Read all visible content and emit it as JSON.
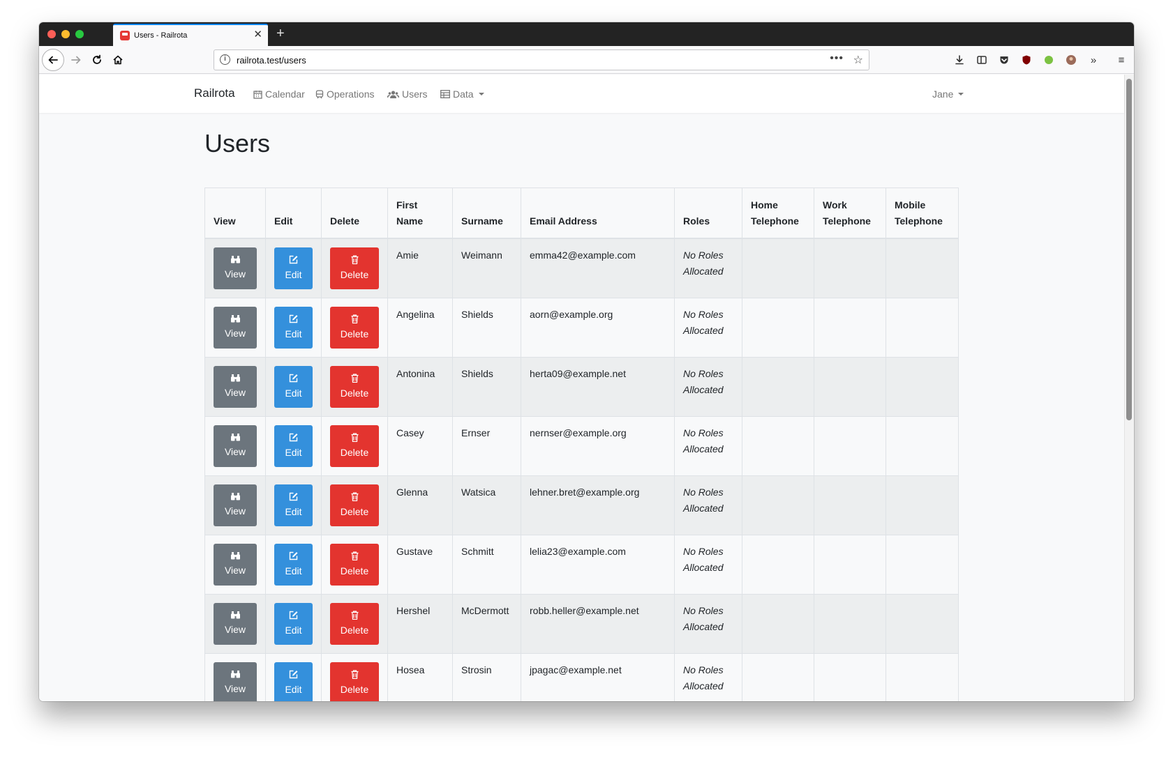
{
  "browser": {
    "tab_title": "Users - Railrota",
    "tab_close": "✕",
    "new_tab": "+",
    "url": "railrota.test/users"
  },
  "app": {
    "brand": "Railrota",
    "nav": {
      "calendar": "Calendar",
      "operations": "Operations",
      "users": "Users",
      "data": "Data"
    },
    "user_menu": "Jane"
  },
  "page": {
    "title": "Users"
  },
  "table": {
    "headers": {
      "view": "View",
      "edit": "Edit",
      "delete": "Delete",
      "first_name": "First Name",
      "surname": "Surname",
      "email": "Email Address",
      "roles": "Roles",
      "home_tel": "Home Telephone",
      "work_tel": "Work Telephone",
      "mobile_tel": "Mobile Telephone"
    },
    "button_labels": {
      "view": "View",
      "edit": "Edit",
      "delete": "Delete"
    },
    "rows": [
      {
        "first_name": "Amie",
        "surname": "Weimann",
        "email": "emma42@example.com",
        "roles": "No Roles Allocated",
        "home": "",
        "work": "",
        "mobile": ""
      },
      {
        "first_name": "Angelina",
        "surname": "Shields",
        "email": "aorn@example.org",
        "roles": "No Roles Allocated",
        "home": "",
        "work": "",
        "mobile": ""
      },
      {
        "first_name": "Antonina",
        "surname": "Shields",
        "email": "herta09@example.net",
        "roles": "No Roles Allocated",
        "home": "",
        "work": "",
        "mobile": ""
      },
      {
        "first_name": "Casey",
        "surname": "Ernser",
        "email": "nernser@example.org",
        "roles": "No Roles Allocated",
        "home": "",
        "work": "",
        "mobile": ""
      },
      {
        "first_name": "Glenna",
        "surname": "Watsica",
        "email": "lehner.bret@example.org",
        "roles": "No Roles Allocated",
        "home": "",
        "work": "",
        "mobile": ""
      },
      {
        "first_name": "Gustave",
        "surname": "Schmitt",
        "email": "lelia23@example.com",
        "roles": "No Roles Allocated",
        "home": "",
        "work": "",
        "mobile": ""
      },
      {
        "first_name": "Hershel",
        "surname": "McDermott",
        "email": "robb.heller@example.net",
        "roles": "No Roles Allocated",
        "home": "",
        "work": "",
        "mobile": ""
      },
      {
        "first_name": "Hosea",
        "surname": "Strosin",
        "email": "jpagac@example.net",
        "roles": "No Roles Allocated",
        "home": "",
        "work": "",
        "mobile": ""
      },
      {
        "first_name": "",
        "surname": "",
        "email": "",
        "roles": "",
        "home": "",
        "work": "",
        "mobile": ""
      }
    ]
  }
}
